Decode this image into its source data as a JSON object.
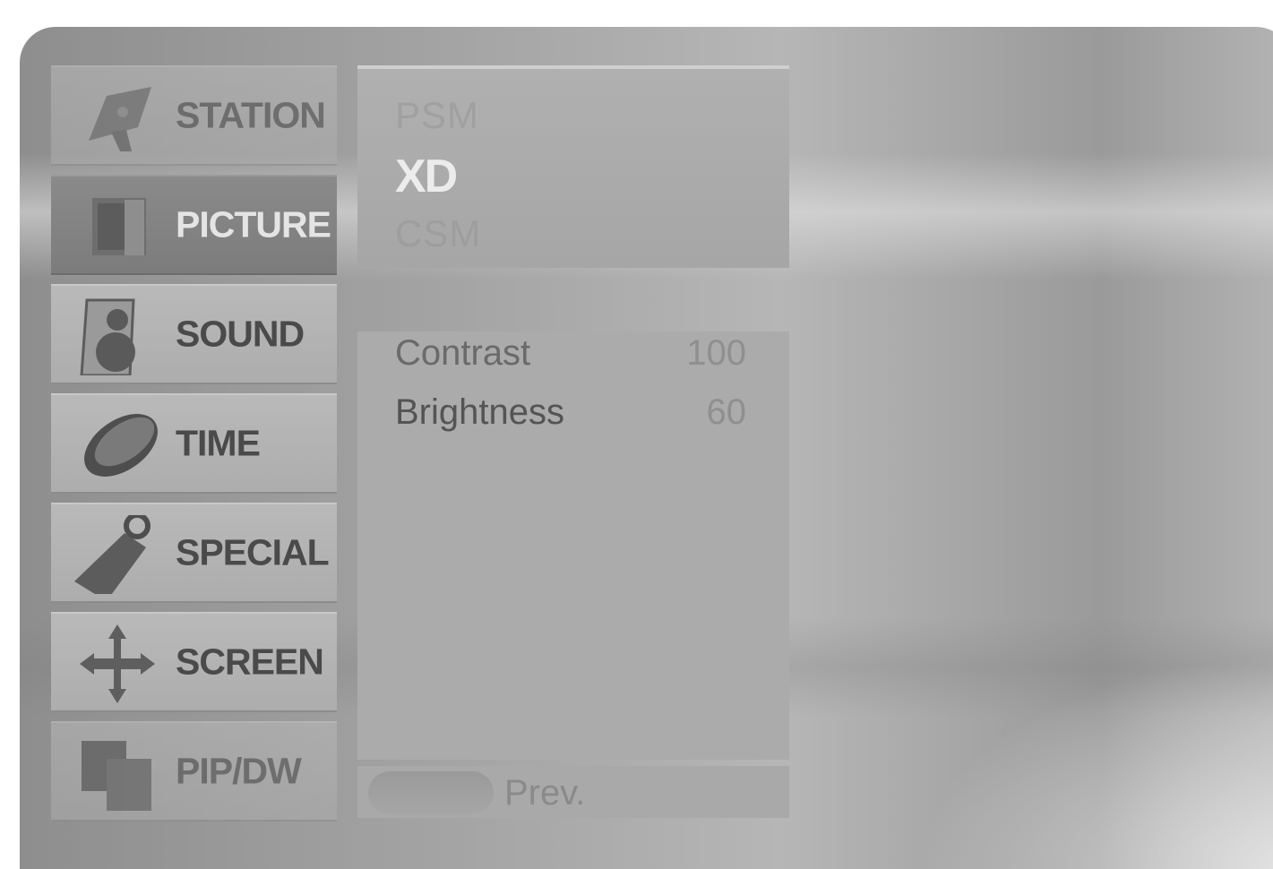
{
  "menu": {
    "items": [
      {
        "label": "STATION",
        "icon": "satellite-dish-icon"
      },
      {
        "label": "PICTURE",
        "icon": "picture-frame-icon"
      },
      {
        "label": "SOUND",
        "icon": "speaker-icon"
      },
      {
        "label": "TIME",
        "icon": "clock-disc-icon"
      },
      {
        "label": "SPECIAL",
        "icon": "tag-icon"
      },
      {
        "label": "SCREEN",
        "icon": "move-arrows-icon"
      },
      {
        "label": "PIP/DW",
        "icon": "double-window-icon"
      }
    ],
    "selected": "PICTURE"
  },
  "picture_modes": {
    "items": [
      "PSM",
      "XD",
      "CSM"
    ],
    "active": "XD"
  },
  "adjustments": [
    {
      "label": "Contrast",
      "value": "100"
    },
    {
      "label": "Brightness",
      "value": "60"
    }
  ],
  "footer": {
    "prev_label": "Prev."
  }
}
